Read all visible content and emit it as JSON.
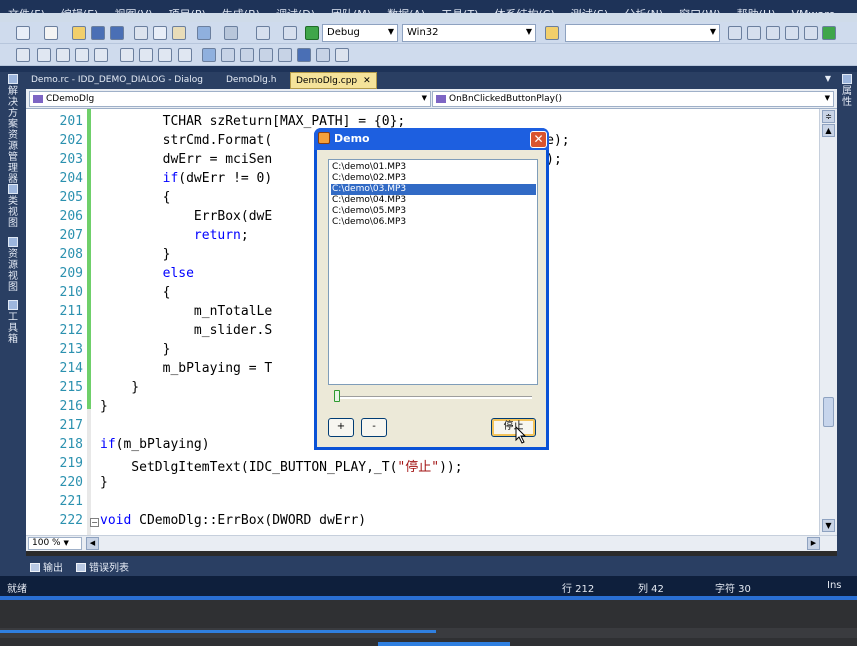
{
  "menubar": {
    "items": [
      "文件(F)",
      "编辑(E)",
      "视图(V)",
      "项目(P)",
      "生成(B)",
      "调试(D)",
      "团队(M)",
      "数据(A)",
      "工具(T)",
      "体系结构(C)",
      "测试(S)",
      "分析(N)",
      "窗口(W)",
      "帮助(H)",
      "VMware"
    ]
  },
  "toolbar": {
    "config_value": "Debug",
    "platform_value": "Win32",
    "find_value": ""
  },
  "left_sidebar": {
    "tabs": [
      "解决方案资源管理器",
      "类视图",
      "资源视图",
      "工具箱"
    ]
  },
  "right_sidebar": {
    "tabs": [
      "属性"
    ]
  },
  "doc_tabs": [
    {
      "label": "Demo.rc - IDD_DEMO_DIALOG - Dialog",
      "active": false
    },
    {
      "label": "DemoDlg.h",
      "active": false
    },
    {
      "label": "DemoDlg.cpp",
      "active": true
    }
  ],
  "nav": {
    "class_value": "CDemoDlg",
    "member_value": "OnBnClickedButtonPlay()"
  },
  "editor": {
    "lines": [
      {
        "num": "201",
        "text": "        TCHAR szReturn[MAX_PATH] = {0};"
      },
      {
        "num": "202",
        "text": "        strCmd.Format(                            hortName);"
      },
      {
        "num": "203",
        "text": "        dwErr = mciSen                          PATH,NULL);"
      },
      {
        "num": "204",
        "text": "        if(dwErr != 0)"
      },
      {
        "num": "205",
        "text": "        {"
      },
      {
        "num": "206",
        "text": "            ErrBox(dwE"
      },
      {
        "num": "207",
        "text": "            return;"
      },
      {
        "num": "208",
        "text": "        }"
      },
      {
        "num": "209",
        "text": "        else"
      },
      {
        "num": "210",
        "text": "        {"
      },
      {
        "num": "211",
        "text": "            m_nTotalLe"
      },
      {
        "num": "212",
        "text": "            m_slider.S"
      },
      {
        "num": "213",
        "text": "        }"
      },
      {
        "num": "214",
        "text": "        m_bPlaying = T"
      },
      {
        "num": "215",
        "text": "    }"
      },
      {
        "num": "216",
        "text": "}"
      },
      {
        "num": "217",
        "text": ""
      },
      {
        "num": "218",
        "text": "if(m_bPlaying)"
      },
      {
        "num": "219",
        "text": "    SetDlgItemText(IDC_BUTTON_PLAY,_T(\"停止\"));"
      },
      {
        "num": "220",
        "text": "}"
      },
      {
        "num": "221",
        "text": ""
      },
      {
        "num": "222",
        "text": "void CDemoDlg::ErrBox(DWORD dwErr)"
      }
    ],
    "zoom": "100 %"
  },
  "bottom_tabs": [
    "输出",
    "错误列表"
  ],
  "status": {
    "ready": "就绪",
    "line": "行 212",
    "col": "列 42",
    "ch": "字符 30",
    "mode": "Ins"
  },
  "dialog": {
    "title": "Demo",
    "close": "✕",
    "files": [
      "C:\\demo\\01.MP3",
      "C:\\demo\\02.MP3",
      "C:\\demo\\03.MP3",
      "C:\\demo\\04.MP3",
      "C:\\demo\\05.MP3",
      "C:\\demo\\06.MP3"
    ],
    "selected_index": 2,
    "slider_position": 0.0,
    "plus_label": "+",
    "minus_label": "-",
    "stop_label": "停止"
  },
  "colors": {
    "ide_chrome": "#1e3358",
    "toolbar": "#cfdbed",
    "active_tab": "#f5e39a",
    "keyword": "#0000ff",
    "string": "#a31515",
    "line_number": "#2b91af",
    "change_bar": "#6fcf6a",
    "dialog_title": "#1d5fe0",
    "list_selection": "#316ac5"
  }
}
